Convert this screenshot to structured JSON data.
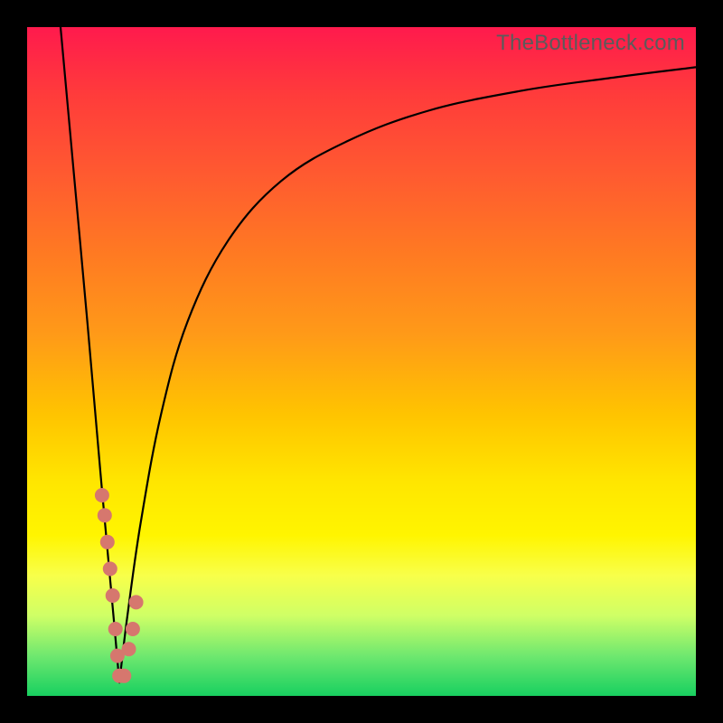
{
  "watermark": "TheBottleneck.com",
  "colors": {
    "frame": "#000000",
    "curve": "#000000",
    "marker": "#d6776e",
    "gradient_stops": [
      {
        "offset": 0.0,
        "color": "#ff1a4d"
      },
      {
        "offset": 0.1,
        "color": "#ff3b3b"
      },
      {
        "offset": 0.22,
        "color": "#ff5a30"
      },
      {
        "offset": 0.34,
        "color": "#ff7a22"
      },
      {
        "offset": 0.46,
        "color": "#ff9a18"
      },
      {
        "offset": 0.58,
        "color": "#ffc400"
      },
      {
        "offset": 0.68,
        "color": "#ffe600"
      },
      {
        "offset": 0.76,
        "color": "#fff500"
      },
      {
        "offset": 0.82,
        "color": "#f8ff4a"
      },
      {
        "offset": 0.88,
        "color": "#cfff66"
      },
      {
        "offset": 0.94,
        "color": "#6fe86f"
      },
      {
        "offset": 1.0,
        "color": "#18d060"
      }
    ]
  },
  "chart_data": {
    "type": "line",
    "title": "",
    "xlabel": "",
    "ylabel": "",
    "xlim": [
      0,
      100
    ],
    "ylim": [
      0,
      100
    ],
    "description": "Bottleneck-style V-curve. Vertical axis encodes bottleneck % (0 at bottom, 100 at top) also color-coded by background gradient (green=low, red=high). Horizontal axis is an unlabeled component-ratio scale. Left branch is a steep near-linear drop to the minimum around x≈14; right branch rises monotonically and flattens toward the right edge. A cluster of salmon dots sits near the minimum.",
    "series": [
      {
        "name": "left-branch",
        "x": [
          5,
          7,
          9,
          11,
          13,
          13.8
        ],
        "y": [
          100,
          78,
          56,
          33,
          11,
          2
        ]
      },
      {
        "name": "right-branch",
        "x": [
          13.8,
          15,
          17,
          20,
          24,
          30,
          38,
          48,
          60,
          74,
          88,
          100
        ],
        "y": [
          2,
          12,
          26,
          42,
          56,
          68,
          77,
          83,
          87.5,
          90.5,
          92.5,
          94
        ]
      }
    ],
    "markers": [
      {
        "x": 11.2,
        "y": 30
      },
      {
        "x": 11.6,
        "y": 27
      },
      {
        "x": 12.0,
        "y": 23
      },
      {
        "x": 12.4,
        "y": 19
      },
      {
        "x": 12.8,
        "y": 15
      },
      {
        "x": 13.2,
        "y": 10
      },
      {
        "x": 13.5,
        "y": 6
      },
      {
        "x": 13.8,
        "y": 3
      },
      {
        "x": 14.5,
        "y": 3
      },
      {
        "x": 15.2,
        "y": 7
      },
      {
        "x": 15.8,
        "y": 10
      },
      {
        "x": 16.3,
        "y": 14
      }
    ]
  }
}
